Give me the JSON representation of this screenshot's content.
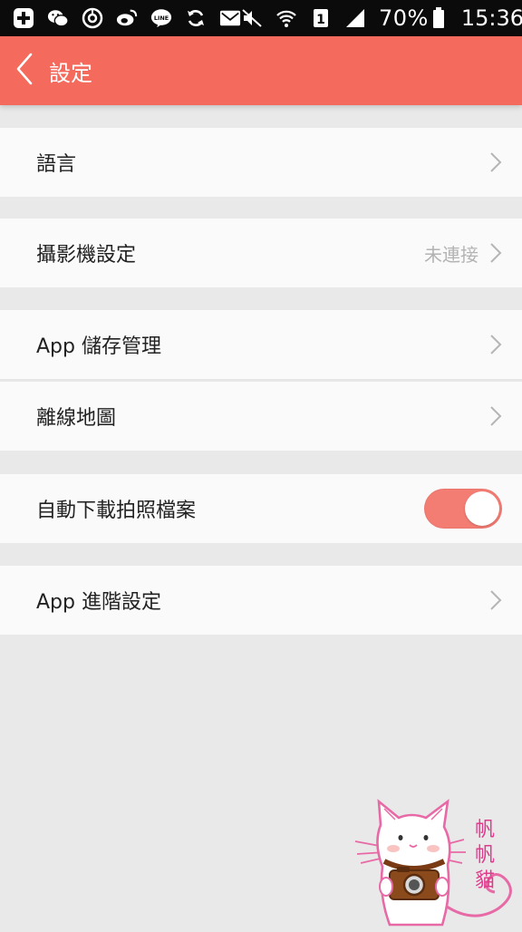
{
  "status_bar": {
    "battery_percent": "70%",
    "time": "15:36",
    "icons": [
      "plus-icon",
      "wechat-icon",
      "alarm-icon",
      "weibo-icon",
      "line-icon",
      "sync-icon",
      "mail-icon",
      "mute-icon",
      "wifi-icon",
      "sim-icon",
      "signal-icon",
      "battery-icon"
    ],
    "sim_label": "1"
  },
  "header": {
    "title": "設定",
    "back_icon": "chevron-left-icon",
    "color": "#f46a5c"
  },
  "settings": {
    "language": {
      "label": "語言"
    },
    "camera": {
      "label": "攝影機設定",
      "value": "未連接"
    },
    "storage": {
      "label": "App 儲存管理"
    },
    "offline_map": {
      "label": "離線地圖"
    },
    "auto_download": {
      "label": "自動下載拍照檔案",
      "enabled": true
    },
    "advanced": {
      "label": "App 進階設定"
    }
  },
  "watermark": {
    "text_lines": [
      "帆",
      "帆",
      "貓"
    ],
    "color": "#e03a8c"
  }
}
